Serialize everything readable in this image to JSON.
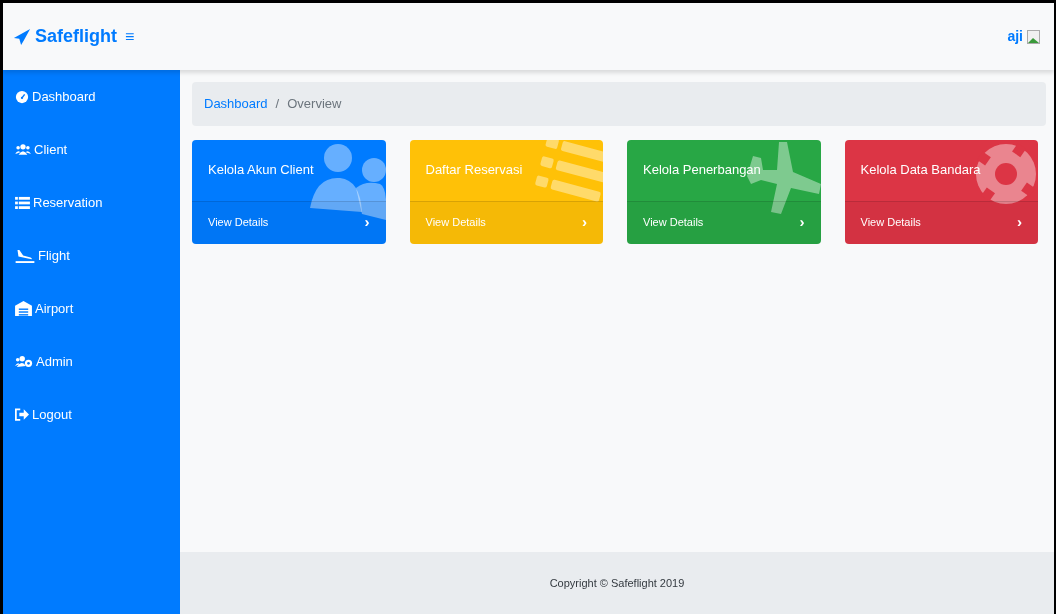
{
  "navbar": {
    "brand": "Safeflight",
    "toggle": "≡",
    "user": "aji"
  },
  "sidebar": {
    "items": [
      {
        "label": "Dashboard",
        "kind": "gauge"
      },
      {
        "label": "Client",
        "kind": "users"
      },
      {
        "label": "Reservation",
        "kind": "list"
      },
      {
        "label": "Flight",
        "kind": "landing"
      },
      {
        "label": "Airport",
        "kind": "warehouse"
      },
      {
        "label": "Admin",
        "kind": "usersgear"
      },
      {
        "label": "Logout",
        "kind": "signout"
      }
    ]
  },
  "breadcrumb": {
    "separator": "/",
    "items": [
      {
        "label": "Dashboard",
        "kind": "link"
      },
      {
        "label": "Overview",
        "kind": "current"
      }
    ]
  },
  "cards": [
    {
      "title": "Kelola Akun Client",
      "link": "View Details",
      "arrow": "›",
      "color": "#007bff",
      "kind": "users"
    },
    {
      "title": "Daftar Reservasi",
      "link": "View Details",
      "arrow": "›",
      "color": "#ffc107",
      "kind": "list"
    },
    {
      "title": "Kelola Penerbangan",
      "link": "View Details",
      "arrow": "›",
      "color": "#28a745",
      "kind": "plane"
    },
    {
      "title": "Kelola Data Bandara",
      "link": "View Details",
      "arrow": "›",
      "color": "#dc3545",
      "kind": "lifebuoy"
    }
  ],
  "footer": {
    "text": "Copyright © Safeflight 2019"
  }
}
